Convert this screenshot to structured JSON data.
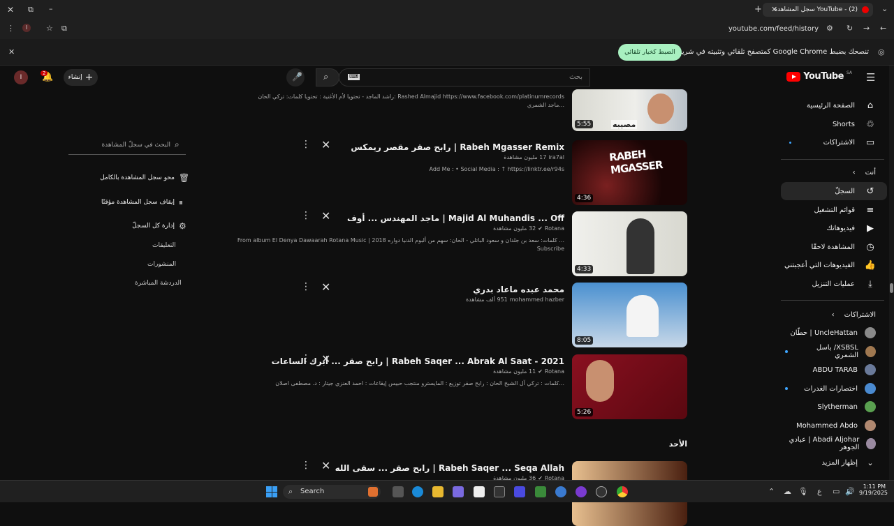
{
  "browser": {
    "tab_title": "YouTube - (2) سجل المشاهدة",
    "url": "youtube.com/feed/history",
    "info_message": "تنصحك بضبط Google Chrome كمتصفح تلقائي وتثبيته في شريط المهام",
    "info_button": "الضبط كخيار تلقائي"
  },
  "header": {
    "logo": "YouTube",
    "logo_region": "SA",
    "search_placeholder": "بحث",
    "create_label": "إنشاء",
    "notif_count": "2",
    "avatar_letter": "I"
  },
  "sidebar": {
    "main": [
      {
        "label": "الصفحة الرئيسية",
        "icon": "home-icon",
        "glyph": "⌂"
      },
      {
        "label": "Shorts",
        "icon": "shorts-icon",
        "glyph": "♲"
      },
      {
        "label": "الاشتراكات",
        "icon": "subscriptions-icon",
        "glyph": "▭"
      }
    ],
    "you_title": "أنت",
    "you": [
      {
        "label": "السجلّ",
        "icon": "history-icon",
        "glyph": "↺"
      },
      {
        "label": "قوائم التشغيل",
        "icon": "playlists-icon",
        "glyph": "≡"
      },
      {
        "label": "فيديوهاتك",
        "icon": "your-videos-icon",
        "glyph": "▶"
      },
      {
        "label": "المشاهدة لاحقًا",
        "icon": "watch-later-icon",
        "glyph": "◷"
      },
      {
        "label": "الفيديوهات التي أعجبتني",
        "icon": "liked-icon",
        "glyph": "👍"
      },
      {
        "label": "عمليات التنزيل",
        "icon": "download-icon",
        "glyph": "⤓"
      }
    ],
    "subs_title": "الاشتراكات",
    "subs": [
      {
        "label": "UncleHattan | حطّان",
        "color": "#8a8a8a",
        "dot": false
      },
      {
        "label": "XSBSL/ باسل الشمري",
        "color": "#a07850",
        "dot": true
      },
      {
        "label": "ABDU TARAB",
        "color": "#6a7a9a",
        "dot": false
      },
      {
        "label": "اختصارات الغدرات",
        "color": "#4a8ad0",
        "dot": true
      },
      {
        "label": "Slytherman",
        "color": "#5aa050",
        "dot": false
      },
      {
        "label": "Mohammed Abdo",
        "color": "#b08870",
        "dot": false
      },
      {
        "label": "Abadi Aljohar | عبادي الجوهر",
        "color": "#9a8aa0",
        "dot": false
      }
    ],
    "show_more": "إظهار المزيد"
  },
  "top_desc": {
    "line1": "راشد الماجد - تحتويا لأم الأغنية : تحتويا كلمات: تركي الحان: Rashed Almajid https://www.facebook.com/platinumrecords",
    "line2": "ماجد الشمري..."
  },
  "videos": [
    {
      "title": "رابح صقر مقصر ريمكس | Rabeh Mgasser Remix",
      "channel": "ira7al",
      "views": "17 مليون مشاهدة",
      "desc": "Add Me : • Social Media : ↑ https://linktr.ee/r94s",
      "duration": "4:36",
      "verified": false,
      "thumb": "thumb1"
    },
    {
      "title": "ماجد المهندس ... أوف | Majid Al Muhandis ... Off",
      "channel": "Rotana",
      "views": "32 مليون مشاهدة",
      "desc": "From album El Denya Dawaarah Rotana Music | كلمات: سعد بن جلدان و سعود الباتلي - الحان: سهم من ألبوم الدنيا دواره 2018 ...",
      "desc2": "Subscribe",
      "duration": "4:33",
      "verified": true,
      "thumb": "thumb2"
    },
    {
      "title": "محمد عبده ماعاد بدري",
      "channel": "mohammed hazber",
      "views": "951 ألف مشاهدة",
      "desc": "",
      "duration": "8:05",
      "verified": false,
      "thumb": "thumb3"
    },
    {
      "title": "رابح صقر ... أبرك الساعات | Rabeh Saqer ... Abrak Al Saat - 2021",
      "channel": "Rotana",
      "views": "11 مليون مشاهدة",
      "desc": "كلمات : تركي آل الشيخ الحان : رابح صقر توزيع : المايسترو منتجب حبيس إيقاعات : احمد العنزي جيتار : د. مصطفى اصلان...",
      "duration": "5:26",
      "verified": true,
      "thumb": "thumb4"
    },
    {
      "title": "رابح صقر ... سقى الله | Rabeh Saqer ... Seqa Allah",
      "channel": "Rotana",
      "views": "36 مليون مشاهدة",
      "desc": "",
      "duration": "",
      "verified": true,
      "thumb": "thumb5"
    }
  ],
  "first_thumb": {
    "duration": "5:55",
    "caption": "مصيبه"
  },
  "section_heading": "الأحد",
  "right_panel": {
    "search_placeholder": "البحث في سجلّ المشاهدة",
    "clear": "محو سجل المشاهدة بالكامل",
    "pause": "إيقاف سجل المشاهدة مؤقتًا",
    "manage": "إدارة كل السجلّ",
    "links": [
      "التعليقات",
      "المنشورات",
      "الدردشة المباشرة"
    ]
  },
  "taskbar": {
    "search": "Search",
    "time": "1:11 PM",
    "date": "9/19/2025"
  }
}
